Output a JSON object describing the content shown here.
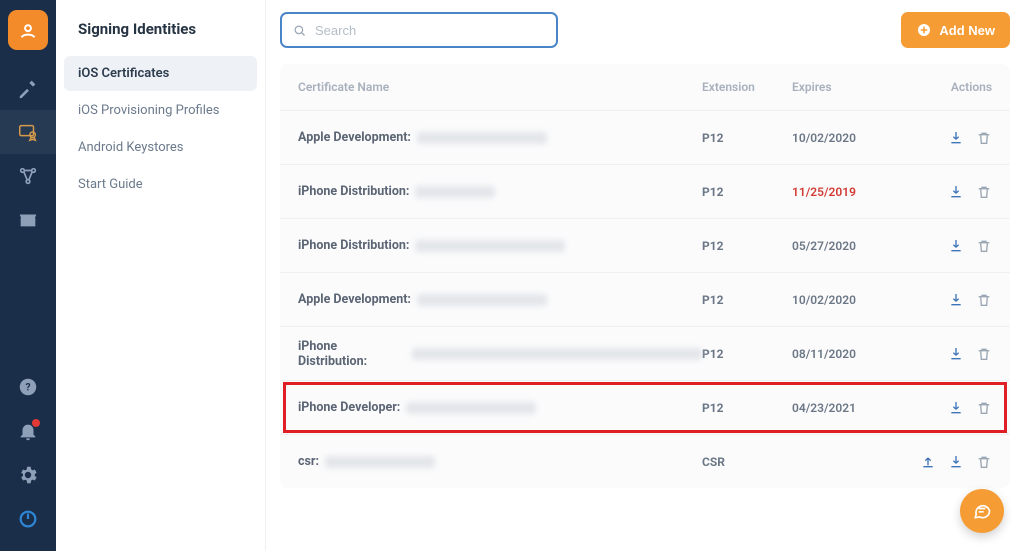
{
  "rail": {
    "items": [
      "build",
      "signing",
      "distribute",
      "store"
    ],
    "active_index": 1,
    "bottom": [
      "help",
      "notifications",
      "settings",
      "power"
    ]
  },
  "sidebar": {
    "title": "Signing Identities",
    "items": [
      {
        "label": "iOS Certificates"
      },
      {
        "label": "iOS Provisioning Profiles"
      },
      {
        "label": "Android Keystores"
      },
      {
        "label": "Start Guide"
      }
    ],
    "active_index": 0
  },
  "toolbar": {
    "search_placeholder": "Search",
    "add_label": "Add New"
  },
  "table": {
    "columns": {
      "name": "Certificate Name",
      "extension": "Extension",
      "expires": "Expires",
      "actions": "Actions"
    },
    "rows": [
      {
        "name_prefix": "Apple Development:",
        "redact_w": 130,
        "extension": "P12",
        "expires": "10/02/2020",
        "expired": false,
        "highlight": false,
        "has_upload": false
      },
      {
        "name_prefix": "iPhone Distribution:",
        "redact_w": 80,
        "extension": "P12",
        "expires": "11/25/2019",
        "expired": true,
        "highlight": false,
        "has_upload": false
      },
      {
        "name_prefix": "iPhone Distribution:",
        "redact_w": 150,
        "extension": "P12",
        "expires": "05/27/2020",
        "expired": false,
        "highlight": false,
        "has_upload": false
      },
      {
        "name_prefix": "Apple Development:",
        "redact_w": 130,
        "extension": "P12",
        "expires": "10/02/2020",
        "expired": false,
        "highlight": false,
        "has_upload": false
      },
      {
        "name_prefix": "iPhone Distribution:",
        "redact_w": 300,
        "extension": "P12",
        "expires": "08/11/2020",
        "expired": false,
        "highlight": false,
        "has_upload": false
      },
      {
        "name_prefix": "iPhone Developer:",
        "redact_w": 130,
        "extension": "P12",
        "expires": "04/23/2021",
        "expired": false,
        "highlight": true,
        "has_upload": false
      },
      {
        "name_prefix": "csr:",
        "redact_w": 110,
        "extension": "CSR",
        "expires": "",
        "expired": false,
        "highlight": false,
        "has_upload": true
      }
    ]
  }
}
